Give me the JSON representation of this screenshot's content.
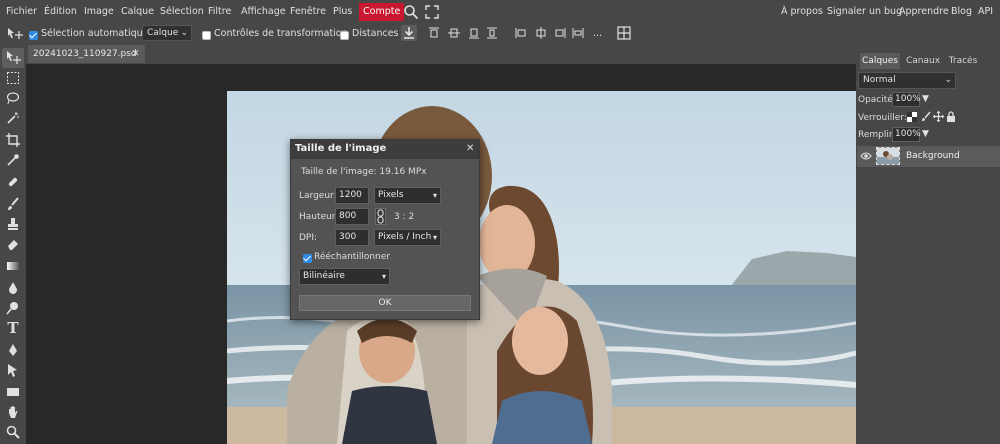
{
  "menubar": {
    "items": [
      "Fichier",
      "Édition",
      "Image",
      "Calque",
      "Sélection",
      "Filtre",
      "Affichage",
      "Fenêtre",
      "Plus"
    ],
    "account": "Compte",
    "right_links": [
      "À propos",
      "Signaler un bug",
      "Apprendre",
      "Blog",
      "API"
    ]
  },
  "options": {
    "auto_select_label": "Sélection automatique",
    "auto_select_checked": true,
    "target_value": "Calque",
    "transform_label": "Contrôles de transformation",
    "transform_checked": false,
    "distances_label": "Distances",
    "distances_checked": false,
    "more": "..."
  },
  "document": {
    "tab_name": "20241023_110927.psd",
    "close": "✕"
  },
  "panel": {
    "tabs": [
      "Calques",
      "Canaux",
      "Tracés"
    ],
    "active_tab": "Calques",
    "blend_mode": "Normal",
    "opacity_label": "Opacité:",
    "opacity_value": "100%",
    "lock_label": "Verrouiller:",
    "fill_label": "Remplir:",
    "fill_value": "100%",
    "layer_name": "Background"
  },
  "dialog": {
    "title": "Taille de l'image",
    "close": "✕",
    "size_info": "Taille de l'image: 19.16 MPx",
    "width_label": "Largeur:",
    "width_value": "1200",
    "width_unit": "Pixels",
    "height_label": "Hauteur:",
    "height_value": "800",
    "ratio": "3 : 2",
    "dpi_label": "DPI:",
    "dpi_value": "300",
    "dpi_unit": "Pixels / Inch",
    "resample_label": "Rééchantillonner",
    "resample_checked": true,
    "method": "Bilinéaire",
    "ok_label": "OK"
  },
  "colors": {
    "accent_red": "#c8172e",
    "checkbox_blue": "#2d8ae6",
    "ui_bg": "#474747",
    "canvas_bg": "#282828"
  },
  "icons": [
    "move-tool-icon",
    "marquee-tool-icon",
    "lasso-tool-icon",
    "magic-wand-icon",
    "crop-tool-icon",
    "eyedropper-icon",
    "healing-brush-icon",
    "brush-tool-icon",
    "stamp-tool-icon",
    "eraser-tool-icon",
    "gradient-tool-icon",
    "blur-tool-icon",
    "dodge-tool-icon",
    "type-tool-icon",
    "pen-tool-icon",
    "path-select-icon",
    "shape-tool-icon",
    "hand-tool-icon",
    "zoom-tool-icon"
  ]
}
